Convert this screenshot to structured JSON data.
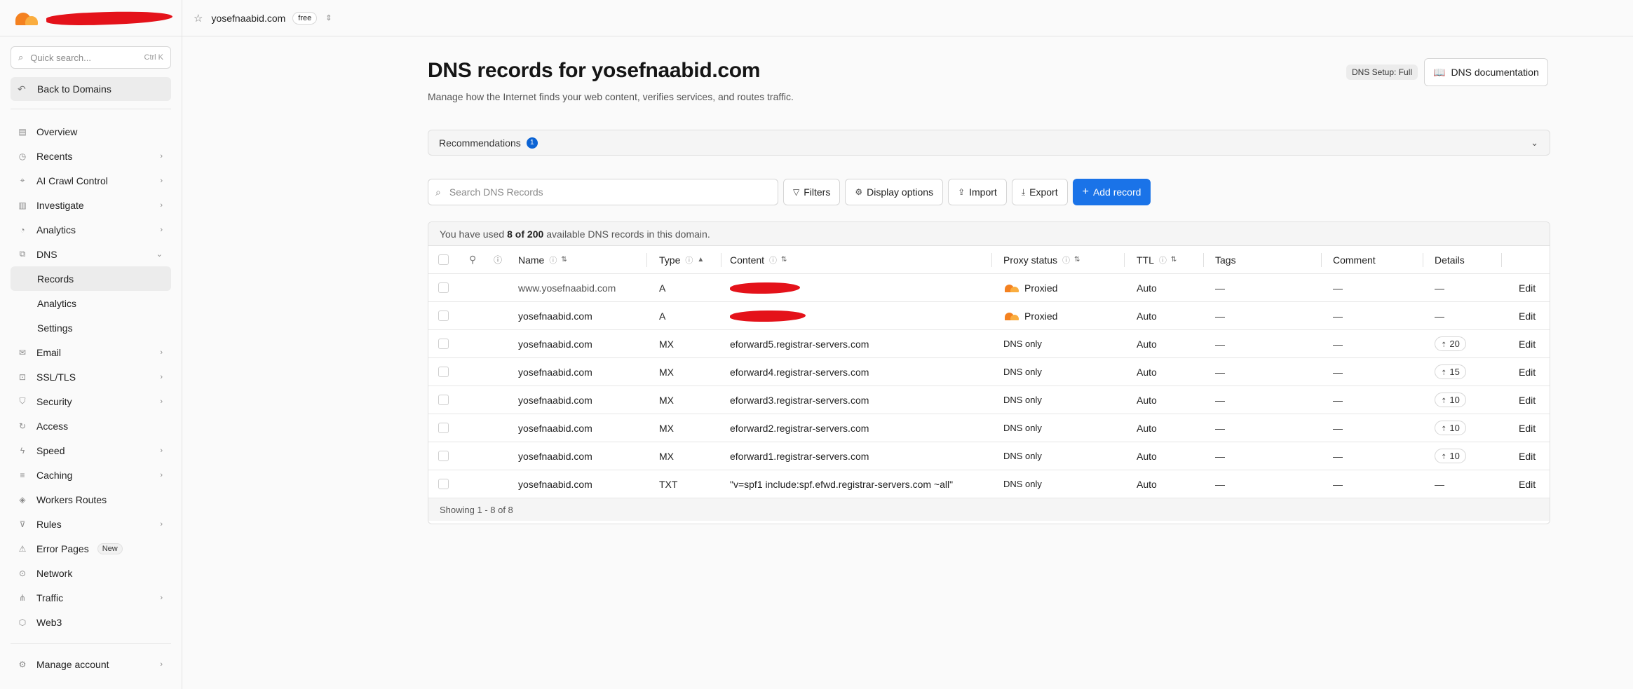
{
  "sidebar": {
    "search_placeholder": "Quick search...",
    "search_shortcut": "Ctrl K",
    "back_label": "Back to Domains",
    "items": [
      {
        "label": "Overview",
        "icon": "clipboard-icon",
        "chevron": false
      },
      {
        "label": "Recents",
        "icon": "clock-icon",
        "chevron": true
      },
      {
        "label": "AI Crawl Control",
        "icon": "robot-icon",
        "chevron": true
      },
      {
        "label": "Investigate",
        "icon": "building-icon",
        "chevron": true
      },
      {
        "label": "Analytics",
        "icon": "chart-icon",
        "chevron": true
      },
      {
        "label": "DNS",
        "icon": "network-icon",
        "chevron": "down"
      },
      {
        "label": "Records",
        "sub": true,
        "active": true
      },
      {
        "label": "Analytics",
        "sub": true
      },
      {
        "label": "Settings",
        "sub": true
      },
      {
        "label": "Email",
        "icon": "mail-icon",
        "chevron": true
      },
      {
        "label": "SSL/TLS",
        "icon": "lock-icon",
        "chevron": true
      },
      {
        "label": "Security",
        "icon": "shield-icon",
        "chevron": true
      },
      {
        "label": "Access",
        "icon": "refresh-icon",
        "chevron": false
      },
      {
        "label": "Speed",
        "icon": "bolt-icon",
        "chevron": true
      },
      {
        "label": "Caching",
        "icon": "database-icon",
        "chevron": true
      },
      {
        "label": "Workers Routes",
        "icon": "workers-icon",
        "chevron": false
      },
      {
        "label": "Rules",
        "icon": "funnel-icon",
        "chevron": true
      },
      {
        "label": "Error Pages",
        "icon": "error-icon",
        "chevron": false,
        "badge": "New"
      },
      {
        "label": "Network",
        "icon": "pin-icon",
        "chevron": false
      },
      {
        "label": "Traffic",
        "icon": "route-icon",
        "chevron": true
      },
      {
        "label": "Web3",
        "icon": "web3-icon",
        "chevron": false
      }
    ],
    "manage_label": "Manage account"
  },
  "topbar": {
    "domain": "yosefnaabid.com",
    "plan": "free"
  },
  "main": {
    "title": "DNS records for yosefnaabid.com",
    "subtitle": "Manage how the Internet finds your web content, verifies services, and routes traffic.",
    "setup_pill": "DNS Setup: Full",
    "doc_button": "DNS documentation",
    "recommendations_label": "Recommendations",
    "recommendations_count": "1",
    "search_placeholder": "Search DNS Records",
    "buttons": {
      "filters": "Filters",
      "display": "Display options",
      "import": "Import",
      "export": "Export",
      "add": "Add record"
    },
    "usage": {
      "pre": "You have used",
      "count": "8 of 200",
      "post": "available DNS records in this domain."
    },
    "columns": {
      "name": "Name",
      "type": "Type",
      "content": "Content",
      "proxy": "Proxy status",
      "ttl": "TTL",
      "tags": "Tags",
      "comment": "Comment",
      "details": "Details"
    },
    "records": [
      {
        "name": "www.yosefnaabid.com",
        "type": "A",
        "content": "",
        "redacted": true,
        "proxy": "Proxied",
        "proxied": true,
        "ttl": "Auto",
        "tags": "—",
        "comment": "—",
        "details": "—",
        "edit": "Edit"
      },
      {
        "name": "yosefnaabid.com",
        "type": "A",
        "content": "",
        "redacted": true,
        "proxy": "Proxied",
        "proxied": true,
        "ttl": "Auto",
        "tags": "—",
        "comment": "—",
        "details": "—",
        "edit": "Edit"
      },
      {
        "name": "yosefnaabid.com",
        "type": "MX",
        "content": "eforward5.registrar-servers.com",
        "proxy": "DNS only",
        "ttl": "Auto",
        "tags": "—",
        "comment": "—",
        "details": "20",
        "priority": true,
        "edit": "Edit"
      },
      {
        "name": "yosefnaabid.com",
        "type": "MX",
        "content": "eforward4.registrar-servers.com",
        "proxy": "DNS only",
        "ttl": "Auto",
        "tags": "—",
        "comment": "—",
        "details": "15",
        "priority": true,
        "edit": "Edit"
      },
      {
        "name": "yosefnaabid.com",
        "type": "MX",
        "content": "eforward3.registrar-servers.com",
        "proxy": "DNS only",
        "ttl": "Auto",
        "tags": "—",
        "comment": "—",
        "details": "10",
        "priority": true,
        "edit": "Edit"
      },
      {
        "name": "yosefnaabid.com",
        "type": "MX",
        "content": "eforward2.registrar-servers.com",
        "proxy": "DNS only",
        "ttl": "Auto",
        "tags": "—",
        "comment": "—",
        "details": "10",
        "priority": true,
        "edit": "Edit"
      },
      {
        "name": "yosefnaabid.com",
        "type": "MX",
        "content": "eforward1.registrar-servers.com",
        "proxy": "DNS only",
        "ttl": "Auto",
        "tags": "—",
        "comment": "—",
        "details": "10",
        "priority": true,
        "edit": "Edit"
      },
      {
        "name": "yosefnaabid.com",
        "type": "TXT",
        "content": "\"v=spf1 include:spf.efwd.registrar-servers.com ~all\"",
        "proxy": "DNS only",
        "ttl": "Auto",
        "tags": "—",
        "comment": "—",
        "details": "—",
        "edit": "Edit"
      }
    ],
    "footer": "Showing 1 - 8 of 8"
  },
  "colors": {
    "accent": "#1a73e8",
    "brand_orange": "#f48120",
    "redaction": "#e4121a"
  }
}
